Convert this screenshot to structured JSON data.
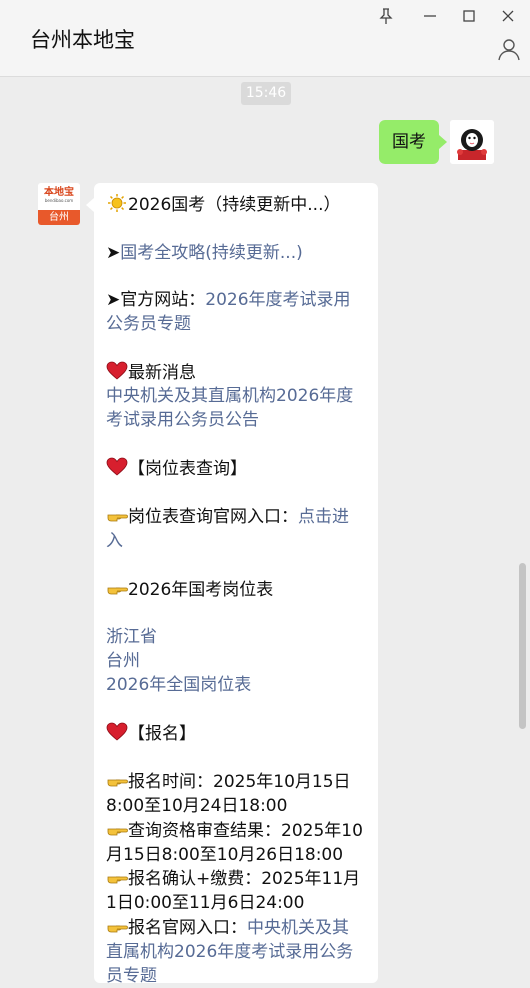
{
  "window": {
    "title": "台州本地宝",
    "buttons": [
      "pin-icon",
      "minimize-icon",
      "maximize-icon",
      "close-icon"
    ]
  },
  "chat": {
    "timestamp": "15:46",
    "my_message": "国考",
    "bot_avatar": {
      "logo_text": "本地宝",
      "logo_sub": "bendibao.com",
      "city": "台州"
    },
    "bot_message": {
      "title": "2026国考（持续更新中...）",
      "l1_arrow": "➤",
      "l1_link": "国考全攻略(持续更新...)",
      "l2_prefix": "➤官方网站：",
      "l2_link_a": "2026年度考试录用",
      "l2_link_b": "公务员专题",
      "news_label": "最新消息",
      "news_link_a": "中央机关及其直属机构2026年度",
      "news_link_b": "考试录用公务员公告",
      "post_label": "【岗位表查询】",
      "post_query_prefix": "岗位表查询官网入口：",
      "post_query_link_a": "点击进",
      "post_query_link_b": "入",
      "post_table_label": "2026年国考岗位表",
      "prov": "浙江省",
      "city": "台州",
      "all": "2026年全国岗位表",
      "signup_label": "【报名】",
      "s1a": "报名时间：2025年10月15日",
      "s1b": "8:00至10月24日18:00",
      "s2a": "查询资格审查结果：2025年10",
      "s2b": "月15日8:00至10月26日18:00",
      "s3a": "报名确认+缴费：2025年11月",
      "s3b": "1日0:00至11月6日24:00",
      "s4_prefix": "报名官网入口：",
      "s4_link_a": "中央机关及其",
      "s4_link_b": "直属机构2026年度考试录用公务",
      "s4_link_c": "员专题"
    }
  },
  "colors": {
    "my_bubble": "#95ec69",
    "link": "#576b95",
    "background": "#ededed"
  },
  "icons": {
    "sun": "sun-icon",
    "heart": "heart-icon",
    "pointing_hand": "pointing-hand-icon"
  }
}
